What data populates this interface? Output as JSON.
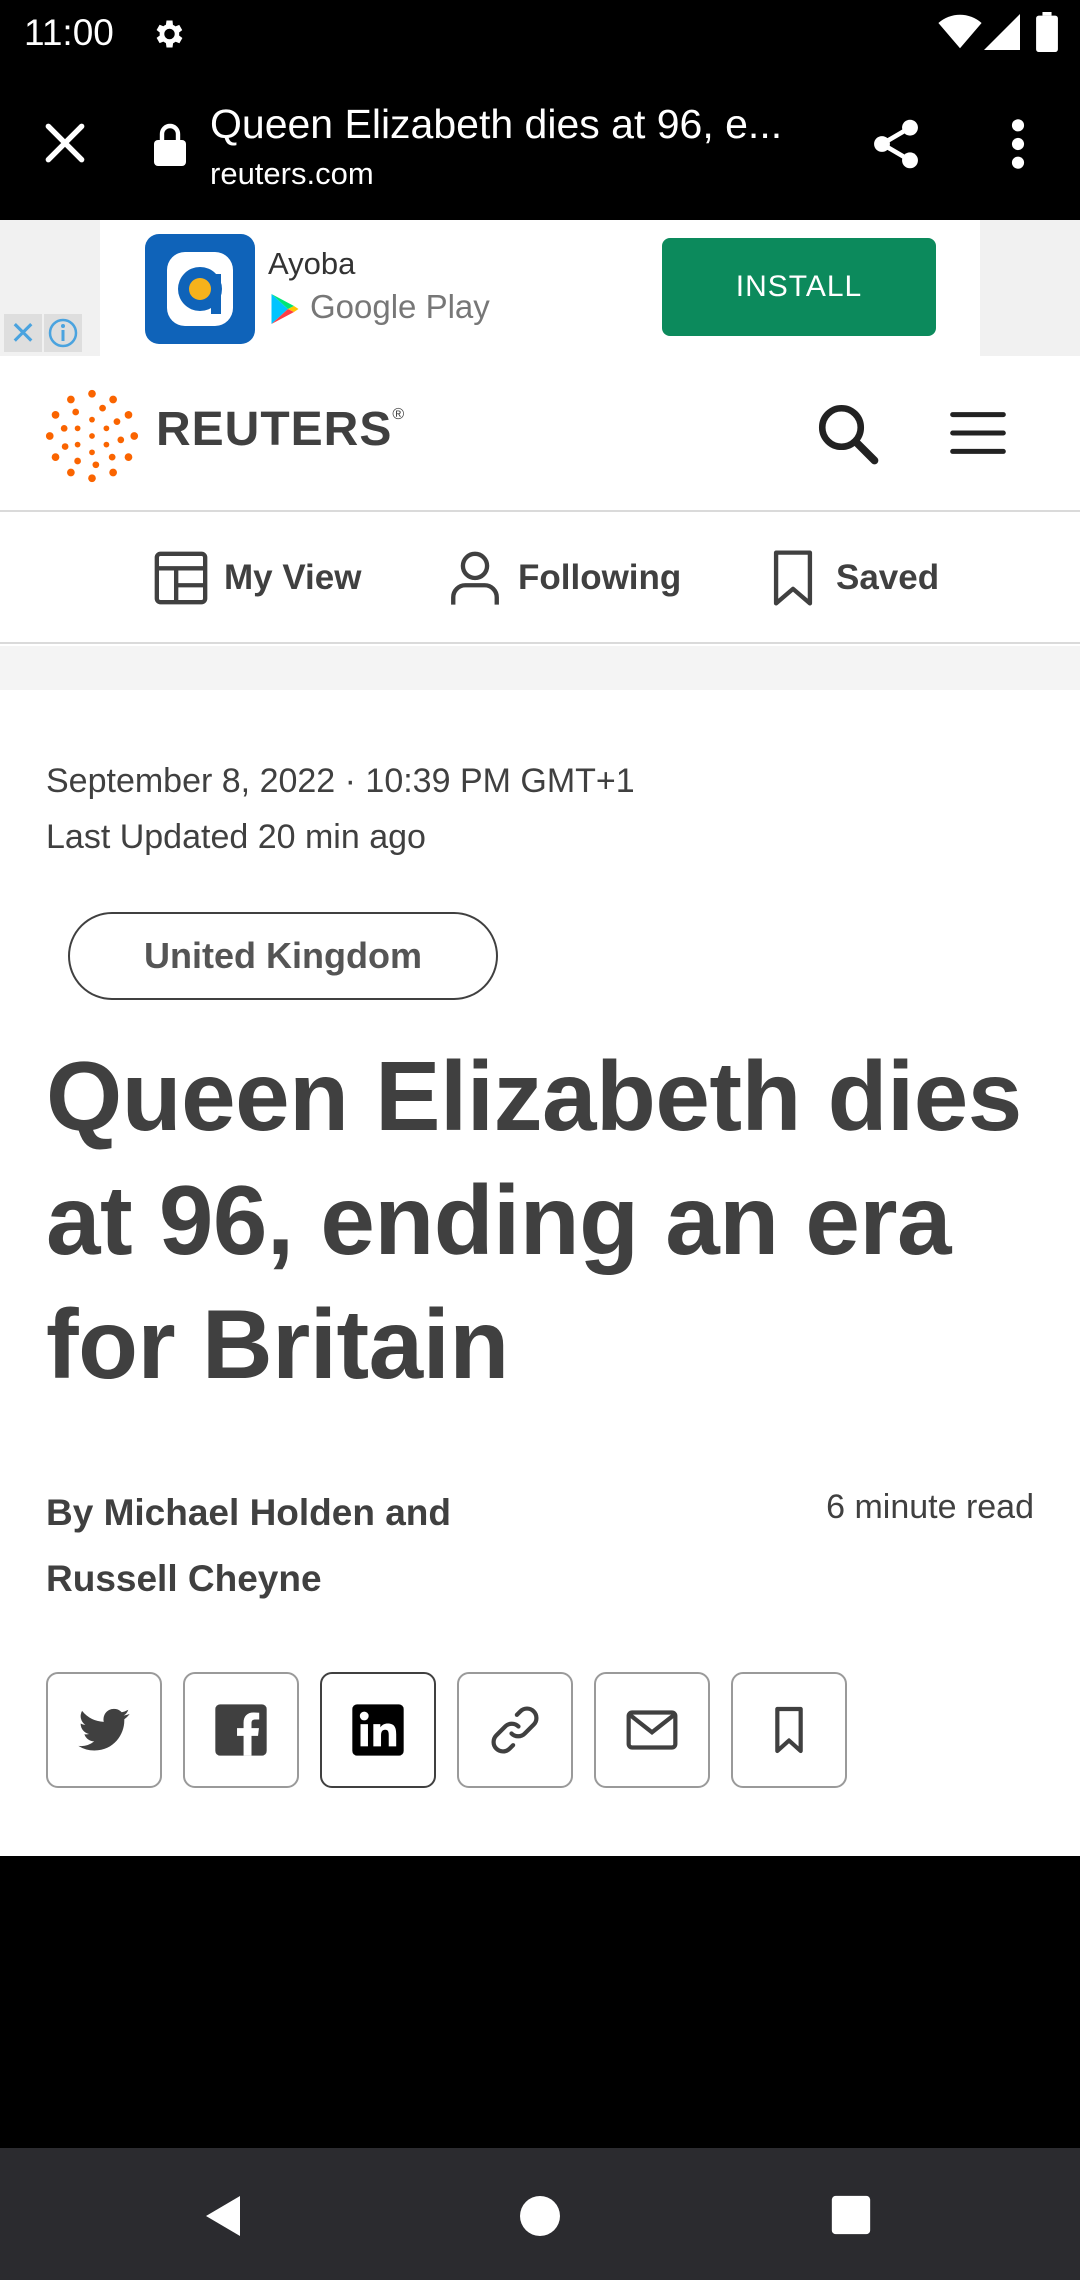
{
  "status_bar": {
    "time": "11:00"
  },
  "toolbar": {
    "title": "Queen Elizabeth dies at 96, e...",
    "url": "reuters.com"
  },
  "ad": {
    "app_name": "Ayoba",
    "store": "Google Play",
    "install_label": "INSTALL",
    "close_glyph": "✕"
  },
  "header": {
    "brand": "REUTERS",
    "registered": "®"
  },
  "nav": {
    "my_view": "My View",
    "following": "Following",
    "saved": "Saved"
  },
  "article": {
    "dateline": "September 8, 2022 · 10:39 PM GMT+1",
    "updated": "Last Updated 20 min ago",
    "topic": "United Kingdom",
    "headline": "Queen Elizabeth dies at 96, ending an era for Britain",
    "byline_line1": "By Michael Holden and",
    "byline_line2": "Russell Cheyne",
    "read_time": "6 minute read"
  },
  "share_icons": [
    "twitter-icon",
    "facebook-icon",
    "linkedin-icon",
    "link-icon",
    "email-icon",
    "bookmark-icon"
  ],
  "colors": {
    "accent": "#fa6400",
    "text": "#404040",
    "install": "#0c8a5c",
    "ad_icon": "#0f63b9"
  }
}
